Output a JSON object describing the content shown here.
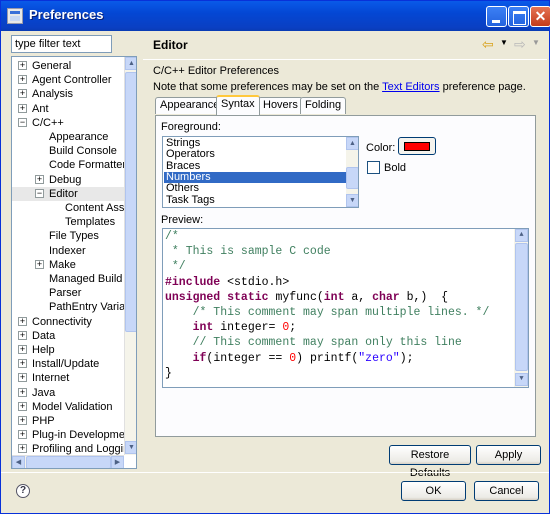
{
  "window": {
    "title": "Preferences"
  },
  "filter": {
    "value": "type filter text"
  },
  "tree": {
    "items": [
      {
        "label": "General",
        "expander": "+",
        "level": 0
      },
      {
        "label": "Agent Controller",
        "expander": "+",
        "level": 0
      },
      {
        "label": "Analysis",
        "expander": "+",
        "level": 0
      },
      {
        "label": "Ant",
        "expander": "+",
        "level": 0
      },
      {
        "label": "C/C++",
        "expander": "−",
        "level": 0
      },
      {
        "label": "Appearance",
        "expander": "",
        "level": 1
      },
      {
        "label": "Build Console",
        "expander": "",
        "level": 1
      },
      {
        "label": "Code Formatter",
        "expander": "",
        "level": 1
      },
      {
        "label": "Debug",
        "expander": "+",
        "level": 1
      },
      {
        "label": "Editor",
        "expander": "−",
        "level": 1,
        "selected": true
      },
      {
        "label": "Content Assis",
        "expander": "",
        "level": 2
      },
      {
        "label": "Templates",
        "expander": "",
        "level": 2
      },
      {
        "label": "File Types",
        "expander": "",
        "level": 1
      },
      {
        "label": "Indexer",
        "expander": "",
        "level": 1
      },
      {
        "label": "Make",
        "expander": "+",
        "level": 1
      },
      {
        "label": "Managed Build",
        "expander": "",
        "level": 1
      },
      {
        "label": "Parser",
        "expander": "",
        "level": 1
      },
      {
        "label": "PathEntry Variabl",
        "expander": "",
        "level": 1
      },
      {
        "label": "Connectivity",
        "expander": "+",
        "level": 0
      },
      {
        "label": "Data",
        "expander": "+",
        "level": 0
      },
      {
        "label": "Help",
        "expander": "+",
        "level": 0
      },
      {
        "label": "Install/Update",
        "expander": "+",
        "level": 0
      },
      {
        "label": "Internet",
        "expander": "+",
        "level": 0
      },
      {
        "label": "Java",
        "expander": "+",
        "level": 0
      },
      {
        "label": "Model Validation",
        "expander": "+",
        "level": 0
      },
      {
        "label": "PHP",
        "expander": "+",
        "level": 0
      },
      {
        "label": "Plug-in Development",
        "expander": "+",
        "level": 0
      },
      {
        "label": "Profiling and Logging",
        "expander": "+",
        "level": 0
      }
    ]
  },
  "page": {
    "title": "Editor",
    "subtitle": "C/C++ Editor Preferences",
    "note_prefix": "Note that some preferences may be set on the ",
    "note_link": "Text Editors",
    "note_suffix": " preference page."
  },
  "tabs": [
    "Appearance",
    "Syntax",
    "Hovers",
    "Folding"
  ],
  "active_tab": "Syntax",
  "syntax": {
    "foreground_label": "Foreground:",
    "items": [
      "Strings",
      "Operators",
      "Braces",
      "Numbers",
      "Others",
      "Task Tags"
    ],
    "selected": "Numbers",
    "color_label": "Color:",
    "color_value": "#ff0000",
    "bold_label": "Bold",
    "bold_checked": false,
    "preview_label": "Preview:"
  },
  "preview_code": [
    [
      {
        "t": "/*",
        "c": "comment"
      }
    ],
    [
      {
        "t": " * This is sample C code",
        "c": "comment"
      }
    ],
    [
      {
        "t": " */",
        "c": "comment"
      }
    ],
    [
      {
        "t": "#include",
        "c": "key"
      },
      {
        "t": " <stdio.h>",
        "c": "plain"
      }
    ],
    [
      {
        "t": "unsigned",
        "c": "key"
      },
      {
        "t": " ",
        "c": "plain"
      },
      {
        "t": "static",
        "c": "key"
      },
      {
        "t": " myfunc(",
        "c": "plain"
      },
      {
        "t": "int",
        "c": "key"
      },
      {
        "t": " a, ",
        "c": "plain"
      },
      {
        "t": "char",
        "c": "key"
      },
      {
        "t": " b,)  {",
        "c": "plain"
      }
    ],
    [
      {
        "t": "    /* This comment may span multiple lines. */",
        "c": "comment"
      }
    ],
    [
      {
        "t": "    ",
        "c": "plain"
      },
      {
        "t": "int",
        "c": "key"
      },
      {
        "t": " integer= ",
        "c": "plain"
      },
      {
        "t": "0",
        "c": "num"
      },
      {
        "t": ";",
        "c": "plain"
      }
    ],
    [
      {
        "t": "    // This comment may span only this line",
        "c": "comment"
      }
    ],
    [
      {
        "t": "    ",
        "c": "plain"
      },
      {
        "t": "if",
        "c": "key"
      },
      {
        "t": "(integer == ",
        "c": "plain"
      },
      {
        "t": "0",
        "c": "num"
      },
      {
        "t": ") printf(",
        "c": "plain"
      },
      {
        "t": "\"zero\"",
        "c": "str"
      },
      {
        "t": ");",
        "c": "plain"
      }
    ],
    [
      {
        "t": "}",
        "c": "plain"
      }
    ]
  ],
  "buttons": {
    "restore_defaults": "Restore Defaults",
    "apply": "Apply",
    "ok": "OK",
    "cancel": "Cancel"
  },
  "icons": {
    "back": "back-arrow-icon",
    "forward": "forward-arrow-icon",
    "help": "help-icon"
  }
}
